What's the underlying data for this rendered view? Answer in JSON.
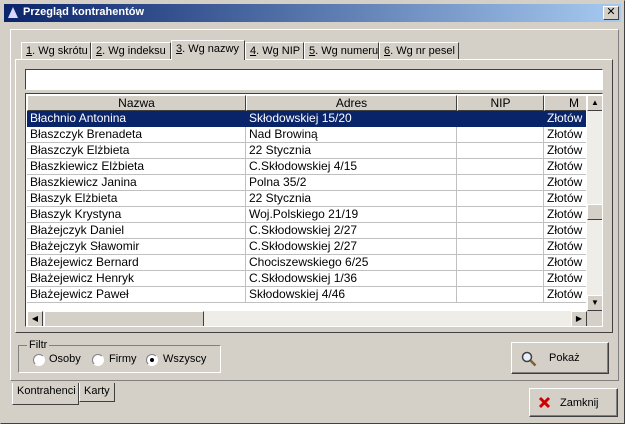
{
  "window": {
    "title": "Przegląd kontrahentów",
    "close_label": "✕"
  },
  "tabs": [
    {
      "num": "1",
      "label": ". Wg skrótu"
    },
    {
      "num": "2",
      "label": ". Wg indeksu"
    },
    {
      "num": "3",
      "label": ". Wg nazwy"
    },
    {
      "num": "4",
      "label": ". Wg NIP"
    },
    {
      "num": "5",
      "label": ". Wg numeru"
    },
    {
      "num": "6",
      "label": ". Wg nr pesel"
    }
  ],
  "search": {
    "value": ""
  },
  "grid": {
    "columns": [
      "Nazwa",
      "Adres",
      "NIP",
      "M"
    ],
    "rows": [
      [
        "Błachnio Antonina",
        "Skłodowskiej 15/20",
        "",
        "Złotów"
      ],
      [
        "Błaszczyk Brenadeta",
        "Nad Browiną",
        "",
        "Złotów"
      ],
      [
        "Błaszczyk Elżbieta",
        "22 Stycznia",
        "",
        "Złotów"
      ],
      [
        "Błaszkiewicz Elżbieta",
        "C.Skłodowskiej 4/15",
        "",
        "Złotów"
      ],
      [
        "Błaszkiewicz Janina",
        "Polna 35/2",
        "",
        "Złotów"
      ],
      [
        "Błaszyk Elżbieta",
        "22 Stycznia",
        "",
        "Złotów"
      ],
      [
        "Błaszyk Krystyna",
        "Woj.Polskiego 21/19",
        "",
        "Złotów"
      ],
      [
        "Błażejczyk Daniel",
        "C.Skłodowskiej 2/27",
        "",
        "Złotów"
      ],
      [
        "Błażejczyk Sławomir",
        "C.Skłodowskiej 2/27",
        "",
        "Złotów"
      ],
      [
        "Błażejewicz Bernard",
        "Chociszewskiego 6/25",
        "",
        "Złotów"
      ],
      [
        "Błażejewicz Henryk",
        "C.Skłodowskiej 1/36",
        "",
        "Złotów"
      ],
      [
        "Błażejewicz Paweł",
        "Skłodowskiej 4/46",
        "",
        "Złotów"
      ]
    ],
    "selected_index": 0
  },
  "filter": {
    "legend": "Filtr",
    "options": [
      "Osoby",
      "Firmy",
      "Wszyscy"
    ],
    "selected": "Wszyscy"
  },
  "buttons": {
    "show": "Pokaż",
    "close": "Zamknij"
  },
  "bottom_tabs": [
    "Kontrahenci",
    "Karty"
  ],
  "icons": {
    "show": "magnifier-icon",
    "close": "red-x-icon"
  },
  "colors": {
    "title_start": "#0a246a",
    "title_end": "#a6caf0",
    "selection": "#0a246a",
    "face": "#d4d0c8"
  }
}
